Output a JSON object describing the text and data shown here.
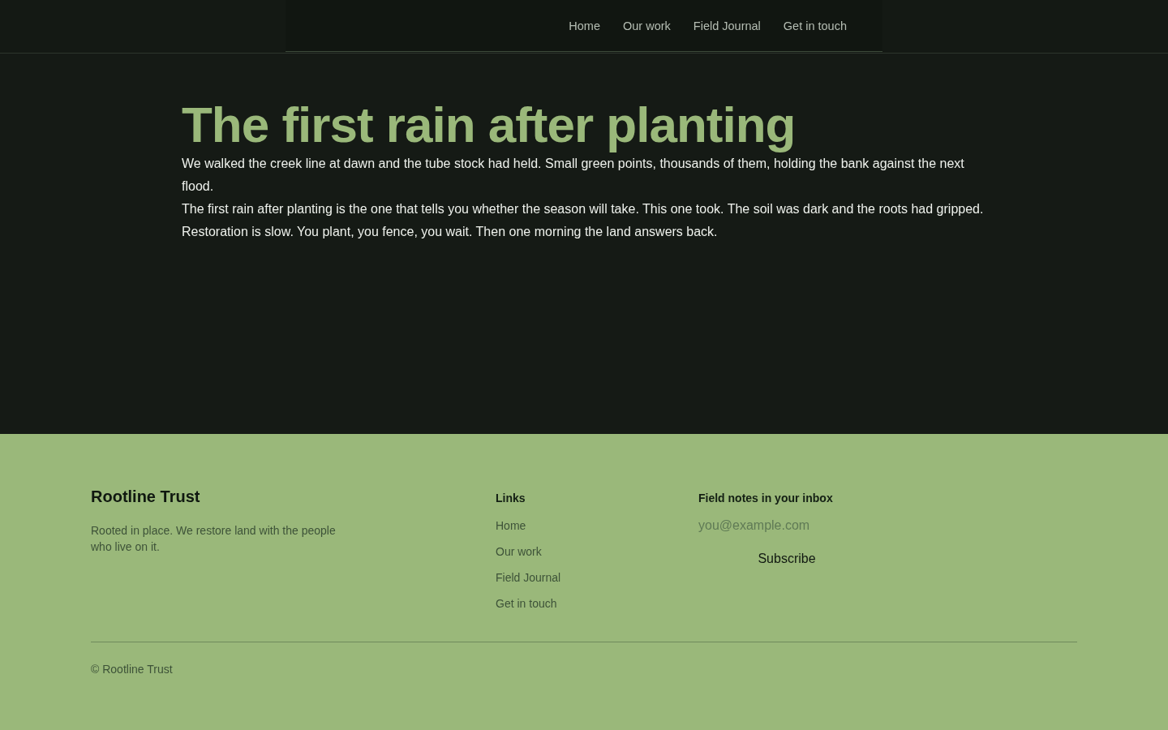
{
  "nav": {
    "links": [
      {
        "label": "Home"
      },
      {
        "label": "Our work"
      },
      {
        "label": "Field Journal"
      },
      {
        "label": "Get in touch"
      }
    ]
  },
  "article": {
    "title": "The first rain after planting",
    "paragraphs": [
      "We walked the creek line at dawn and the tube stock had held. Small green points, thousands of them, holding the bank against the next flood.",
      "The first rain after planting is the one that tells you whether the season will take. This one took. The soil was dark and the roots had gripped.",
      "Restoration is slow. You plant, you fence, you wait. Then one morning the land answers back."
    ]
  },
  "footer": {
    "brand": "Rootline Trust",
    "tagline": "Rooted in place. We restore land with the people who live on it.",
    "links_heading": "Links",
    "links": [
      {
        "label": "Home"
      },
      {
        "label": "Our work"
      },
      {
        "label": "Field Journal"
      },
      {
        "label": "Get in touch"
      }
    ],
    "newsletter": {
      "heading": "Field notes in your inbox",
      "placeholder": "you@example.com",
      "button": "Subscribe"
    },
    "copyright": "© Rootline Trust"
  }
}
